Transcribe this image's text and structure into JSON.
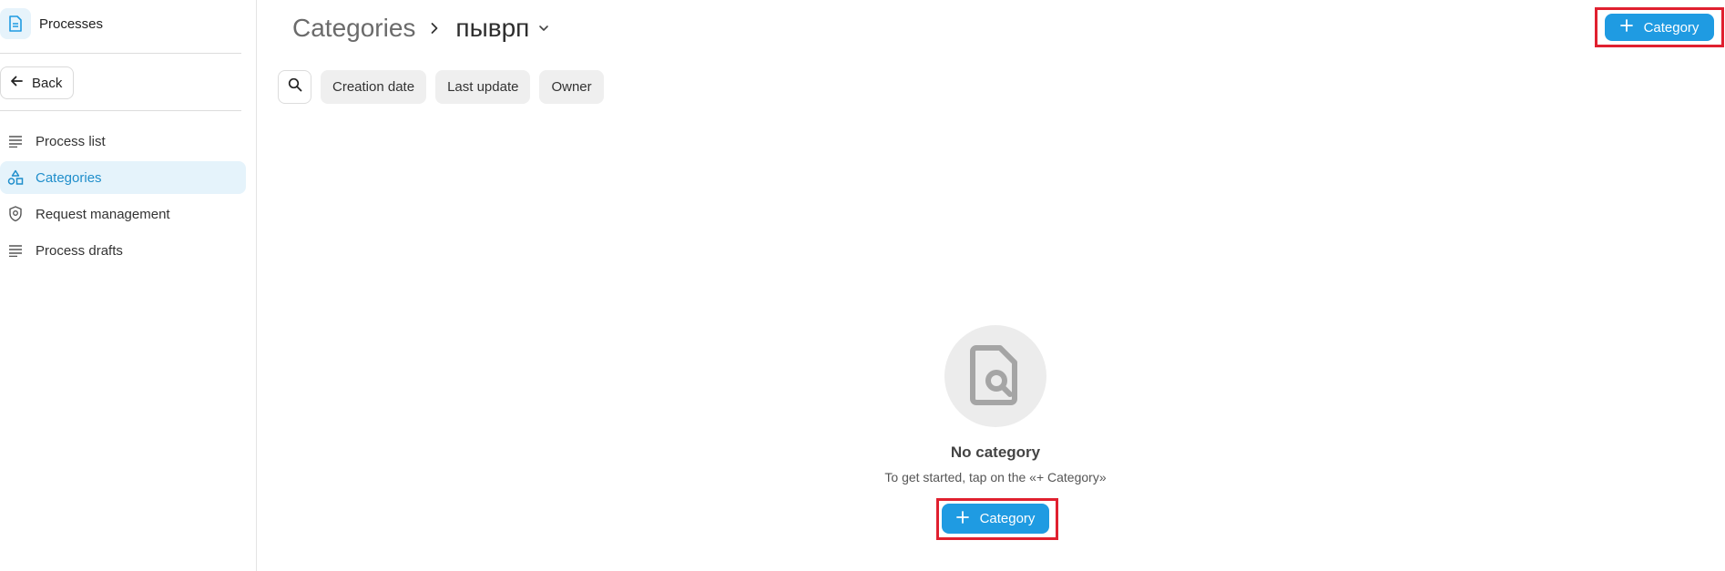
{
  "app": {
    "title": "Processes"
  },
  "sidebar": {
    "back_label": "Back",
    "items": [
      {
        "label": "Process list",
        "icon": "list-icon",
        "active": false
      },
      {
        "label": "Categories",
        "icon": "shapes-icon",
        "active": true
      },
      {
        "label": "Request management",
        "icon": "shield-icon",
        "active": false
      },
      {
        "label": "Process drafts",
        "icon": "list-icon",
        "active": false
      }
    ]
  },
  "header": {
    "breadcrumb_root": "Categories",
    "breadcrumb_current": "пыврп",
    "add_button_label": "Category"
  },
  "filters": {
    "chips": [
      "Creation date",
      "Last update",
      "Owner"
    ]
  },
  "empty_state": {
    "title": "No category",
    "subtitle": "To get started, tap on the «+ Category»",
    "button_label": "Category"
  },
  "colors": {
    "accent": "#1f9be2",
    "highlight": "#e0202f",
    "active_nav_bg": "#e5f3fb"
  }
}
